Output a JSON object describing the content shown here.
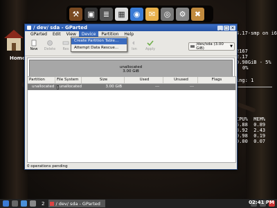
{
  "desktop": {
    "home_label": "Home"
  },
  "dock": {
    "icons": [
      "terminal-icon",
      "file-manager-icon",
      "text-editor-icon",
      "spreadsheet-icon",
      "browser-icon",
      "mail-icon",
      "media-icon",
      "tools-icon",
      "settings-icon"
    ]
  },
  "conky": {
    "kernel": "4.17-smp on i686)",
    "num1": "2167",
    "num2": "2.17",
    "mem": "0.98GiB - 5%",
    "pct": "0%",
    "ng": "ing: 1",
    "cpu_header": "CPU%  MEM%",
    "rows": [
      "5.88  0.89",
      "3.92  2.43",
      "0.98  0.19",
      "0.00  0.07"
    ]
  },
  "window": {
    "title": "/ dev/ sda - GParted",
    "menus": [
      "GParted",
      "Edit",
      "View",
      "Device",
      "Partition",
      "Help"
    ],
    "toolbar": {
      "new": "New",
      "delete": "Delete",
      "resize": "Res",
      "apply_partial": "Ion",
      "apply": "Apply"
    },
    "device_select": "/dev/sda   (3.00 GiB)",
    "graph": {
      "label": "unallocated",
      "size": "3.00 GiB"
    },
    "columns": [
      "Partition",
      "File System",
      "Size",
      "Used",
      "Unused",
      "Flags"
    ],
    "rows": [
      {
        "partition": "unallocated",
        "filesystem": "unallocated",
        "size": "3.00 GiB",
        "used": "---",
        "unused": "---",
        "flags": ""
      }
    ],
    "status": "0 operations pending"
  },
  "device_menu": {
    "items": [
      "Create Partition Table...",
      "Attempt Data Rescue..."
    ]
  },
  "taskbar": {
    "workspace": "2",
    "task_label": "/ dev/ sda - GParted",
    "clock": "02:41 PM"
  }
}
